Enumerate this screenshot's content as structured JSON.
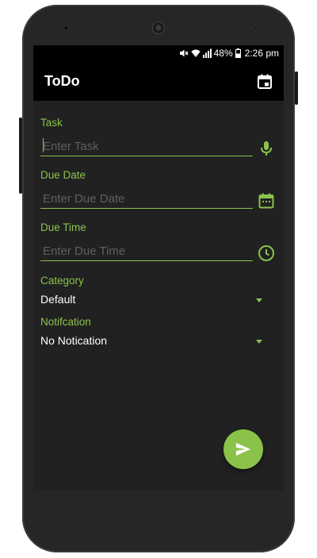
{
  "status_bar": {
    "battery": "48%",
    "time": "2:26 pm"
  },
  "app_bar": {
    "title": "ToDo",
    "action_icon": "calendar-icon"
  },
  "form": {
    "task": {
      "label": "Task",
      "placeholder": "Enter Task",
      "value": "",
      "icon": "microphone-icon"
    },
    "due_date": {
      "label": "Due Date",
      "placeholder": "Enter Due Date",
      "value": "",
      "icon": "calendar-icon"
    },
    "due_time": {
      "label": "Due Time",
      "placeholder": "Enter Due Time",
      "value": "",
      "icon": "clock-icon"
    },
    "category": {
      "label": "Category",
      "selected": "Default"
    },
    "notification": {
      "label": "Notifcation",
      "selected": "No Notication"
    }
  },
  "fab": {
    "icon": "send-icon"
  },
  "colors": {
    "accent": "#8bc34a",
    "background": "#212121",
    "app_bar": "#000000",
    "text": "#ffffff"
  }
}
